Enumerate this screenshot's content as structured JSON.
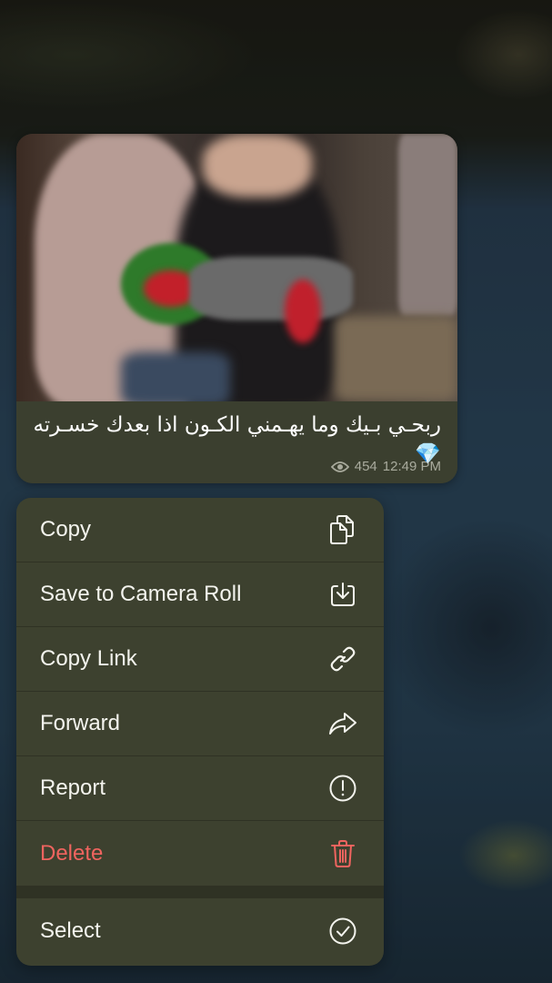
{
  "message": {
    "caption": "ربحـي بـيك وما يهـمني الكـون اذا بعدك خسـرته💎",
    "views": "454",
    "time": "12:49 PM"
  },
  "menu": {
    "items": [
      {
        "label": "Copy",
        "icon": "copy-icon"
      },
      {
        "label": "Save to Camera Roll",
        "icon": "download-icon"
      },
      {
        "label": "Copy Link",
        "icon": "link-icon"
      },
      {
        "label": "Forward",
        "icon": "forward-icon"
      },
      {
        "label": "Report",
        "icon": "report-icon"
      },
      {
        "label": "Delete",
        "icon": "trash-icon",
        "color": "#f0645f"
      },
      {
        "label": "Select",
        "icon": "checkmark-circle-icon"
      }
    ]
  }
}
